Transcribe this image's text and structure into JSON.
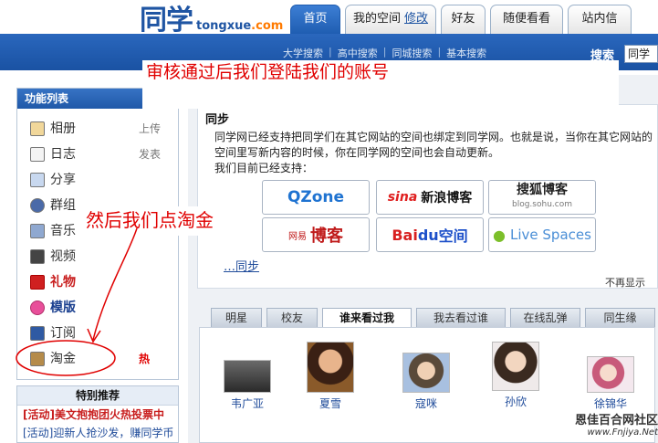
{
  "header": {
    "logo_cn": "同学",
    "logo_domain": "tongxue",
    "logo_tld": ".com",
    "tabs": {
      "home": "首页",
      "my_space": "我的空间",
      "my_space_edit": "修改",
      "friends": "好友",
      "random": "随便看看",
      "messages": "站内信"
    }
  },
  "subnav": [
    "大学搜索",
    "高中搜索",
    "同城搜索",
    "基本搜索"
  ],
  "subnav_separator": "|",
  "search": {
    "label": "搜索",
    "value": "同学"
  },
  "annotations": {
    "note1": "审核通过后我们登陆我们的账号",
    "note2": "然后我们点淘金"
  },
  "sidebar": {
    "title": "功能列表",
    "items": [
      {
        "label": "相册",
        "aside": "上传",
        "icon": "photo-album-icon"
      },
      {
        "label": "日志",
        "aside": "发表",
        "icon": "diary-icon"
      },
      {
        "label": "分享",
        "aside": "",
        "icon": "share-icon"
      },
      {
        "label": "群组",
        "aside": "",
        "icon": "group-icon"
      },
      {
        "label": "音乐",
        "aside": "",
        "icon": "music-icon"
      },
      {
        "label": "视频",
        "aside": "",
        "icon": "video-icon"
      },
      {
        "label": "礼物",
        "aside": "",
        "icon": "gift-icon"
      },
      {
        "label": "模版",
        "aside": "",
        "icon": "template-icon"
      },
      {
        "label": "订阅",
        "aside": "",
        "icon": "subscribe-icon"
      },
      {
        "label": "淘金",
        "aside": "热",
        "icon": "gold-icon"
      }
    ]
  },
  "featured": {
    "title": "特别推荐",
    "items": [
      "[活动]美文抱抱团火热投票中",
      "[活动]迎新人抢沙发，赚同学币"
    ]
  },
  "sync": {
    "title": "同步",
    "description": "同学网已经支持把同学们在其它网站的空间也绑定到同学网。也就是说，当你在其它网站的空间里写新内容的时候，你在同学网的空间也会自动更新。",
    "supported_label": "我们目前已经支持：",
    "link_partial": "…同步",
    "dismiss": "不再显示",
    "partners": {
      "qzone": "QZone",
      "sina_brand": "sina",
      "sina_text": "新浪博客",
      "sohu_text": "搜狐博客",
      "sohu_url": "blog.sohu.com",
      "netease_small": "网易",
      "netease_text": "博客",
      "baidu_brand": "Bai",
      "baidu_du": "du",
      "baidu_text": "空间",
      "live_text": "Live Spaces"
    }
  },
  "friend_tabs": [
    "明星",
    "校友",
    "谁来看过我",
    "我去看过谁",
    "在线乱弹",
    "同生缘"
  ],
  "friend_tabs_active": 2,
  "visitors": [
    "韦广亚",
    "夏雪",
    "寇咪",
    "孙欣",
    "徐锦华"
  ],
  "watermark": {
    "line1": "恩佳百合网社区",
    "line2": "www.Fnjiya.Net"
  },
  "colors": {
    "brand_blue": "#1f55a3",
    "nav_blue": "#1a52a3",
    "annotation_red": "#e00000",
    "hot_red": "#e00000"
  }
}
